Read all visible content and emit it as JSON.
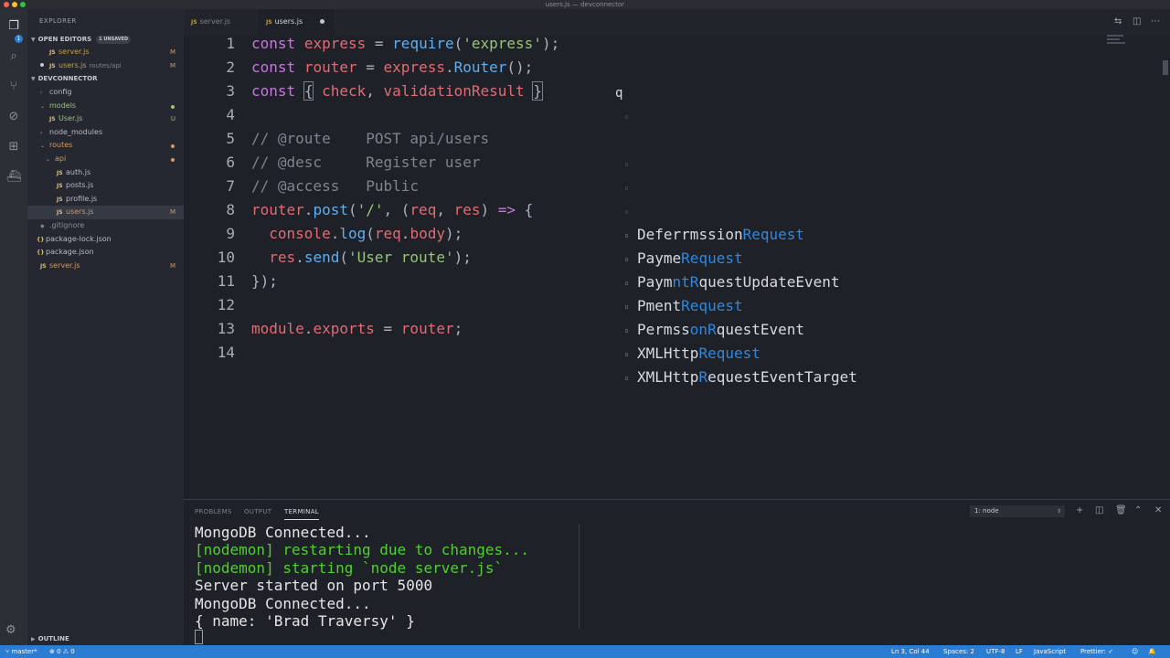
{
  "window": {
    "title": "users.js — devconnector"
  },
  "activity_bar": {
    "badge": "1"
  },
  "explorer": {
    "title": "EXPLORER",
    "open_editors": {
      "label": "OPEN EDITORS",
      "badge": "1 UNSAVED"
    },
    "open_items": [
      {
        "icon": "JS",
        "name": "server.js",
        "path": "",
        "status": "M"
      },
      {
        "icon": "JS",
        "name": "users.js",
        "path": "routes/api",
        "status": "M"
      }
    ],
    "project": {
      "label": "DEVCONNECTOR"
    },
    "tree": [
      {
        "icon": "›",
        "name": "config",
        "status": ""
      },
      {
        "icon": "⌄",
        "name": "models",
        "status": ""
      },
      {
        "icon": "JS",
        "name": "User.js",
        "status": "U"
      },
      {
        "icon": "›",
        "name": "node_modules",
        "status": ""
      },
      {
        "icon": "⌄",
        "name": "routes",
        "status": ""
      },
      {
        "icon": "⌄",
        "name": "api",
        "status": ""
      },
      {
        "icon": "JS",
        "name": "auth.js",
        "status": ""
      },
      {
        "icon": "JS",
        "name": "posts.js",
        "status": ""
      },
      {
        "icon": "JS",
        "name": "profile.js",
        "status": ""
      },
      {
        "icon": "JS",
        "name": "users.js",
        "status": "M"
      },
      {
        "icon": "◆",
        "name": ".gitignore",
        "status": ""
      },
      {
        "icon": "{}",
        "name": "package-lock.json",
        "status": ""
      },
      {
        "icon": "{}",
        "name": "package.json",
        "status": ""
      },
      {
        "icon": "JS",
        "name": "server.js",
        "status": "M"
      }
    ],
    "outline": "OUTLINE"
  },
  "tabs": [
    {
      "icon": "JS",
      "label": "server.js"
    },
    {
      "icon": "JS",
      "label": "users.js"
    }
  ],
  "editor": {
    "line_numbers": [
      "1",
      "2",
      "3",
      "4",
      "5",
      "6",
      "7",
      "8",
      "9",
      "10",
      "11",
      "12",
      "13",
      "14"
    ],
    "typed_char": "q"
  },
  "suggestions": [
    {
      "parts": [
        "Defe",
        "r",
        "rm",
        "ssion",
        "Request"
      ]
    },
    {
      "parts": [
        "Payme",
        "",
        "",
        "",
        "Request"
      ]
    },
    {
      "parts": [
        "Paym",
        "ntR",
        "",
        "questUpdateEvent",
        ""
      ]
    },
    {
      "parts": [
        "P",
        "",
        "",
        "ment",
        "Request"
      ]
    },
    {
      "parts": [
        "Perm",
        "ss",
        "onR",
        "",
        "questEvent"
      ]
    },
    {
      "parts": [
        "XMLHttp",
        "",
        "",
        "",
        "Request"
      ]
    },
    {
      "parts": [
        "XMLHt",
        "tp",
        "R",
        "",
        "equestEventTarget"
      ]
    }
  ],
  "panel": {
    "tabs": [
      "PROBLEMS",
      "OUTPUT",
      "TERMINAL"
    ],
    "terminal_select": "1: node",
    "lines": [
      "MongoDB Connected...",
      "[nodemon] restarting due to changes...",
      "[nodemon] starting `node server.js`",
      "Server started on port 5000",
      "MongoDB Connected...",
      "{ name: 'Brad Traversy' }"
    ]
  },
  "statusbar": {
    "branch": "master*",
    "problems": "0",
    "warnings": "0",
    "position": "Ln 3, Col 44",
    "spaces": "Spaces: 2",
    "encoding": "UTF-8",
    "eol": "LF",
    "language": "JavaScript",
    "formatter": "Prettier:"
  }
}
